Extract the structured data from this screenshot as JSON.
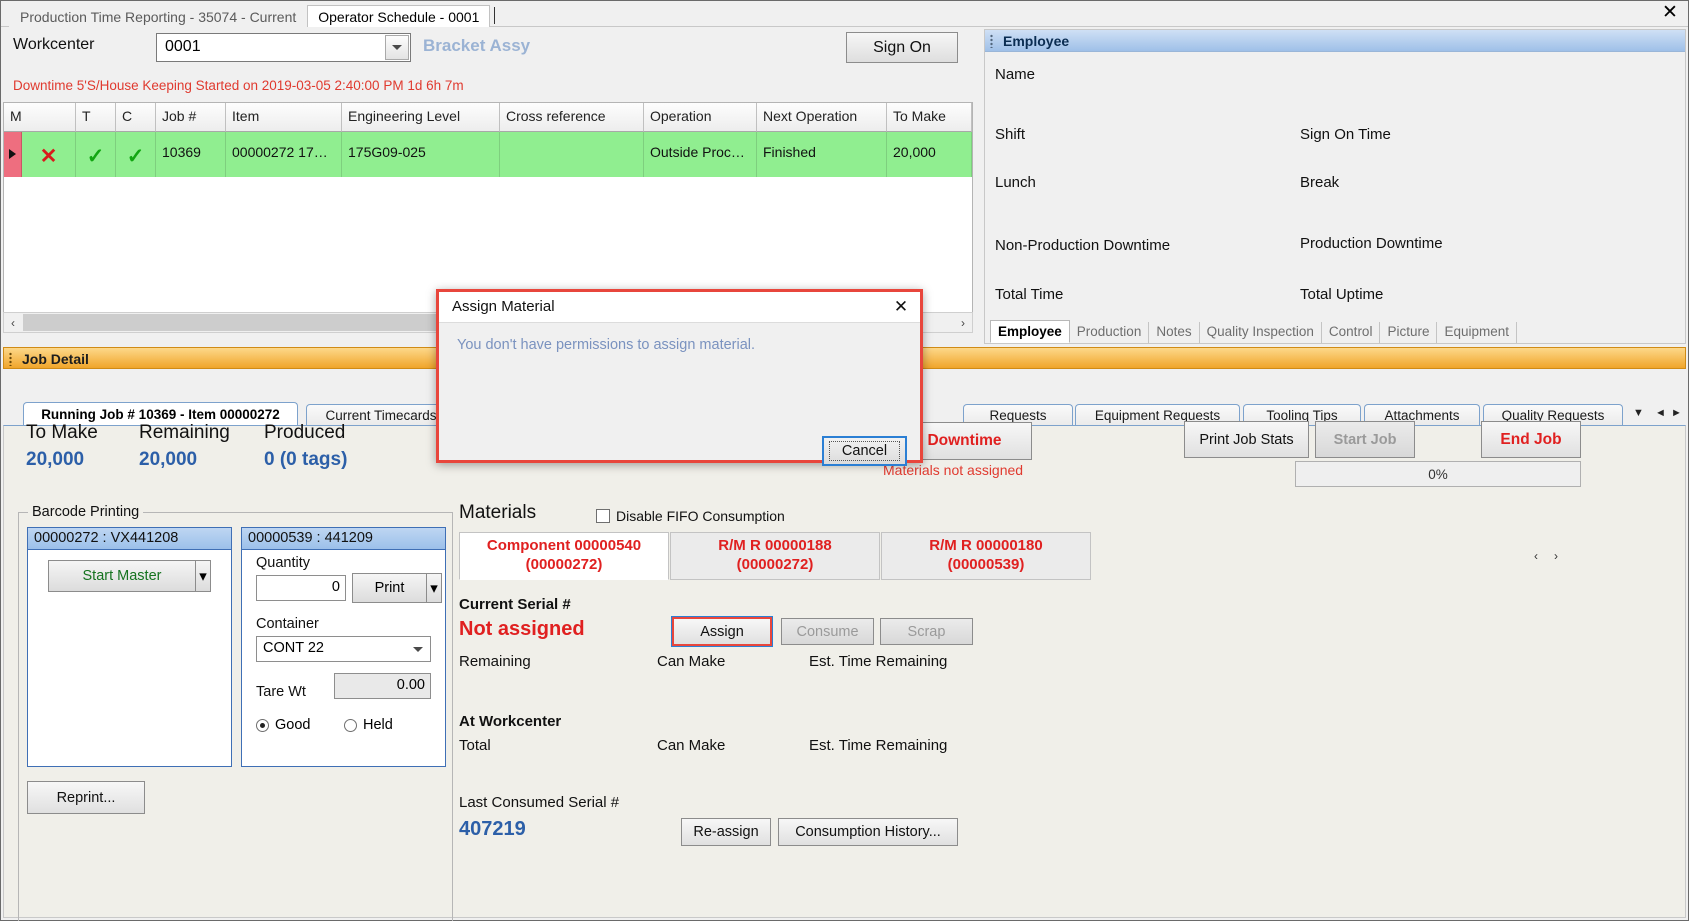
{
  "titlebar": {
    "tabs": [
      {
        "label": "Production Time Reporting - 35074 - Current",
        "active": false
      },
      {
        "label": "Operator Schedule - 0001",
        "active": true
      }
    ],
    "close_label": "✕"
  },
  "workcenter": {
    "label": "Workcenter",
    "value": "0001",
    "name": "Bracket Assy",
    "sign_on_label": "Sign On",
    "downtime_message": "Downtime 5'S/House Keeping Started on 2019-03-05 2:40:00 PM 1d 6h 7m"
  },
  "job_grid": {
    "columns": [
      "M",
      "T",
      "C",
      "Job #",
      "Item",
      "Engineering Level",
      "Cross reference",
      "Operation",
      "Next Operation",
      "To Make"
    ],
    "rows": [
      {
        "m": "✕",
        "t": "✓",
        "c": "✓",
        "job": "10369",
        "item": "00000272  17…",
        "engineering_level": "175G09-025",
        "cross_reference": "",
        "operation": "Outside  Proc…",
        "next_operation": "Finished",
        "to_make": "20,000"
      }
    ],
    "scroll_left": "‹",
    "scroll_right": "›"
  },
  "employee": {
    "header": "Employee",
    "fields": [
      "Name",
      "Shift",
      "Sign On Time",
      "Lunch",
      "Break",
      "Non-Production Downtime",
      "Production Downtime",
      "Total Time",
      "Total Uptime"
    ],
    "tabs": [
      {
        "label": "Employee",
        "active": true
      },
      {
        "label": "Production",
        "active": false
      },
      {
        "label": "Notes",
        "active": false
      },
      {
        "label": "Quality Inspection",
        "active": false
      },
      {
        "label": "Control",
        "active": false
      },
      {
        "label": "Picture",
        "active": false
      },
      {
        "label": "Equipment",
        "active": false
      }
    ],
    "scroll_left": "◄",
    "scroll_right": "►",
    "menu": "▼"
  },
  "job_detail": {
    "header": "Job Detail",
    "tabs": [
      {
        "label": "Running Job # 10369 - Item 00000272",
        "active": true
      },
      {
        "label": "Current Timecards",
        "active": false
      },
      {
        "label": "Requests",
        "active": false
      },
      {
        "label": "Equipment Requests",
        "active": false
      },
      {
        "label": "Tooling Tips",
        "active": false
      },
      {
        "label": "Attachments",
        "active": false
      },
      {
        "label": "Quality Requests",
        "active": false
      }
    ],
    "scroll_down": "▼",
    "scroll_left": "◄",
    "scroll_right": "►",
    "stats": [
      {
        "label": "To Make",
        "value": "20,000"
      },
      {
        "label": "Remaining",
        "value": "20,000"
      },
      {
        "label": "Produced",
        "value": "0 (0 tags)"
      }
    ],
    "downtime_button": "Downtime",
    "materials_warning": "Materials not assigned",
    "print_job_stats": "Print Job Stats",
    "start_job": "Start Job",
    "end_job": "End Job",
    "progress": "0%"
  },
  "barcode_printing": {
    "group_title": "Barcode Printing",
    "left_card": {
      "header": "00000272 : VX441208",
      "start_master": "Start Master",
      "split_arrow": "▾"
    },
    "right_card": {
      "header": "00000539 : 441209",
      "quantity_label": "Quantity",
      "quantity_value": "0",
      "print_label": "Print",
      "split_arrow": "▾",
      "container_label": "Container",
      "container_value": "CONT 22",
      "tare_label": "Tare Wt",
      "tare_value": "0.00",
      "radio_good": "Good",
      "radio_held": "Held"
    },
    "reprint_label": "Reprint..."
  },
  "materials": {
    "title": "Materials",
    "disable_fifo_label": "Disable FIFO Consumption",
    "disable_fifo_checked": false,
    "tabs": [
      {
        "line1": "Component 00000540",
        "line2": "(00000272)",
        "active": true
      },
      {
        "line1": "R/M R 00000188",
        "line2": "(00000272)",
        "active": false
      },
      {
        "line1": "R/M R 00000180",
        "line2": "(00000539)",
        "active": false
      }
    ],
    "tab_nav_left": "‹",
    "tab_nav_right": "›",
    "current_serial_label": "Current Serial #",
    "current_serial_value": "Not assigned",
    "assign_button": "Assign",
    "consume_button": "Consume",
    "scrap_button": "Scrap",
    "remaining_label": "Remaining",
    "can_make_label": "Can Make",
    "est_time_label": "Est. Time Remaining",
    "at_workcenter_label": "At Workcenter",
    "total_label": "Total",
    "wc_can_make_label": "Can Make",
    "wc_est_time_label": "Est. Time Remaining",
    "last_consumed_label": "Last Consumed Serial #",
    "last_consumed_value": "407219",
    "reassign_button": "Re-assign",
    "consumption_history_button": "Consumption History..."
  },
  "modal": {
    "title": "Assign Material",
    "close": "✕",
    "message": "You don't have permissions to assign material.",
    "cancel": "Cancel"
  },
  "colors": {
    "accent_orange": "#f0a52b",
    "accent_blue": "#2c5fa8",
    "error_red": "#e02020",
    "row_green": "#90ee90",
    "modal_border": "#e8463c"
  }
}
